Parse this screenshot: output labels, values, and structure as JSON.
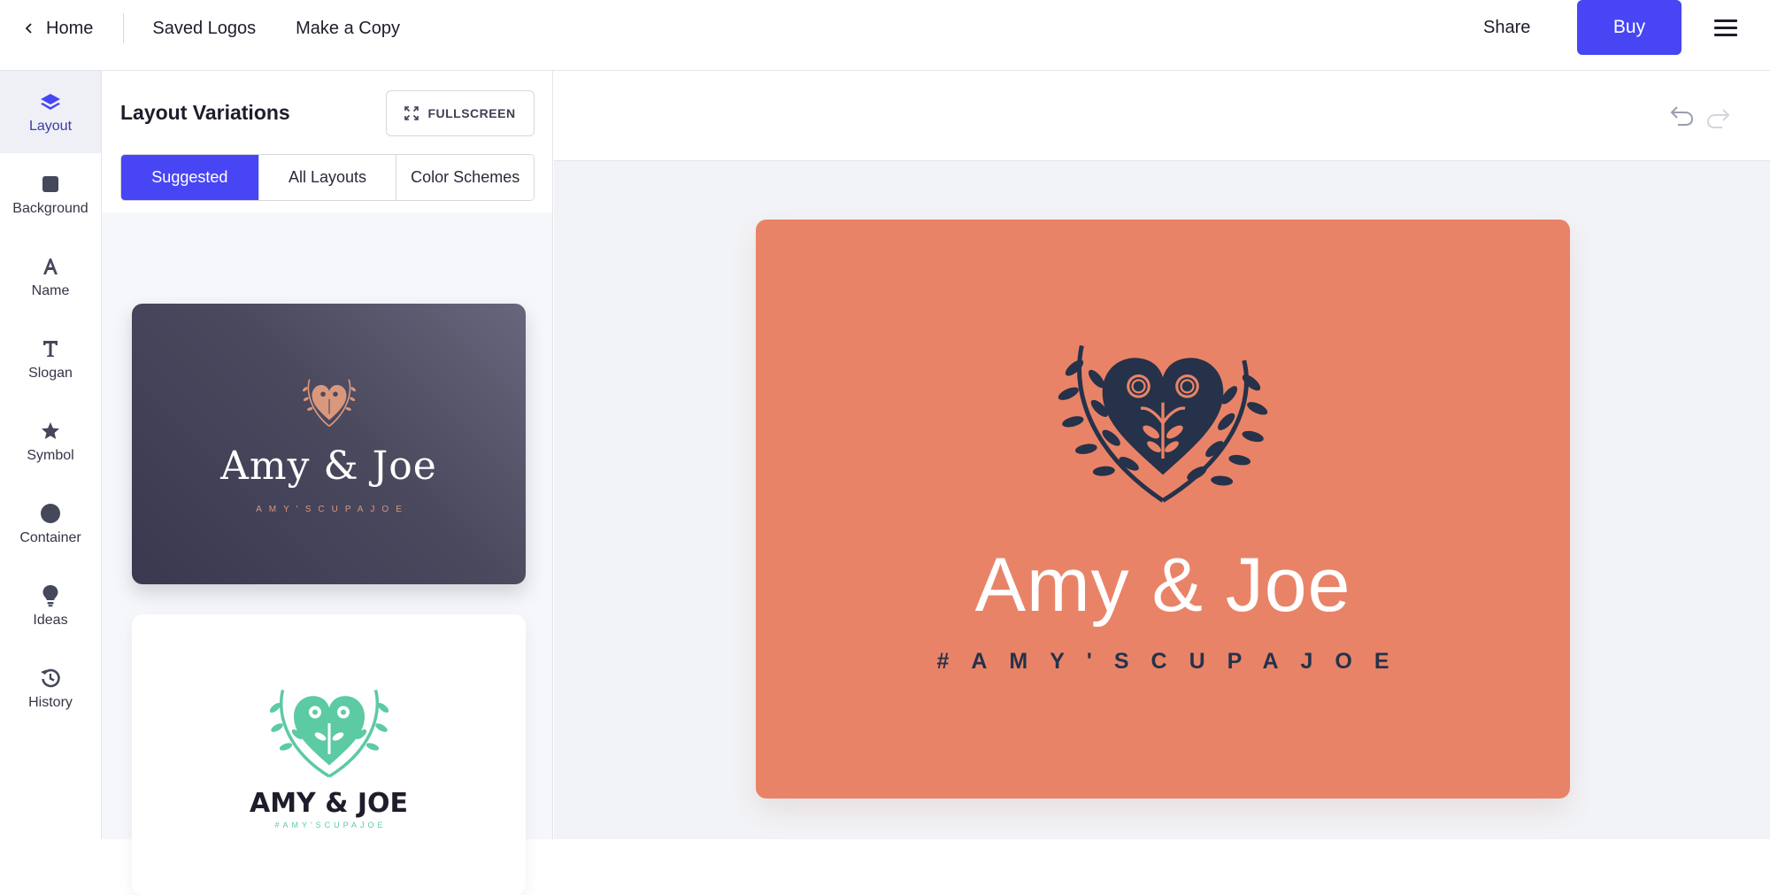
{
  "topbar": {
    "home_label": "Home",
    "saved_logos_label": "Saved Logos",
    "make_copy_label": "Make a Copy",
    "share_label": "Share",
    "buy_label": "Buy"
  },
  "rail": {
    "items": [
      {
        "label": "Layout",
        "icon": "layers-icon"
      },
      {
        "label": "Background",
        "icon": "square-icon"
      },
      {
        "label": "Name",
        "icon": "letter-a-icon"
      },
      {
        "label": "Slogan",
        "icon": "letter-t-icon"
      },
      {
        "label": "Symbol",
        "icon": "star-icon"
      },
      {
        "label": "Container",
        "icon": "circle-icon"
      },
      {
        "label": "Ideas",
        "icon": "lightbulb-icon"
      },
      {
        "label": "History",
        "icon": "history-icon"
      }
    ]
  },
  "panel": {
    "title": "Layout Variations",
    "fullscreen_label": "FULLSCREEN",
    "tabs": [
      "Suggested",
      "All Layouts",
      "Color Schemes"
    ],
    "cards": [
      {
        "name": "Amy & Joe",
        "slogan": "AMY'SCUPAJOE"
      },
      {
        "name": "AMY & JOE",
        "slogan": "#AMY'SCUPAJOE"
      }
    ]
  },
  "logo": {
    "name": "Amy & Joe",
    "slogan": "#AMY'SCUPAJOE",
    "background_color": "#e98367",
    "symbol_color": "#25324a",
    "name_color": "#ffffff"
  },
  "colors": {
    "accent": "#4845f5"
  }
}
